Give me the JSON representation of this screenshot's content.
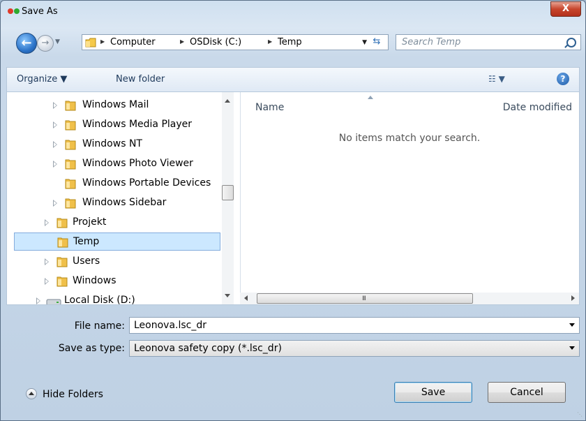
{
  "window": {
    "title": "Save As",
    "close_label": "X",
    "title_dot_colors": [
      "#e03a2a",
      "#2eaa2e"
    ]
  },
  "nav": {
    "back_icon": "arrow-left-icon",
    "forward_icon": "arrow-right-icon",
    "breadcrumbs": [
      "Computer",
      "OSDisk (C:)",
      "Temp"
    ],
    "search_placeholder": "Search Temp"
  },
  "toolbar": {
    "organize_label": "Organize ▼",
    "new_folder_label": "New folder",
    "view_label": "☷ ▼",
    "help_label": "?"
  },
  "tree": {
    "items": [
      {
        "label": "Windows Mail",
        "expandable": true
      },
      {
        "label": "Windows Media Player",
        "expandable": true
      },
      {
        "label": "Windows NT",
        "expandable": true
      },
      {
        "label": "Windows Photo Viewer",
        "expandable": true
      },
      {
        "label": "Windows Portable Devices",
        "expandable": false
      },
      {
        "label": "Windows Sidebar",
        "expandable": true
      },
      {
        "label": "Projekt",
        "expandable": true
      },
      {
        "label": "Temp",
        "expandable": false,
        "selected": true
      },
      {
        "label": "Users",
        "expandable": true
      },
      {
        "label": "Windows",
        "expandable": true
      },
      {
        "label": "Local Disk (D:)",
        "expandable": true
      }
    ]
  },
  "files": {
    "col_name": "Name",
    "col_date": "Date modified",
    "empty_message": "No items match your search."
  },
  "form": {
    "file_name_label": "File name:",
    "file_name_value": "Leonova.lsc_dr",
    "save_type_label": "Save as type:",
    "save_type_value": "Leonova safety copy (*.lsc_dr)"
  },
  "footer": {
    "hide_folders_label": "Hide Folders",
    "save_label": "Save",
    "cancel_label": "Cancel"
  }
}
